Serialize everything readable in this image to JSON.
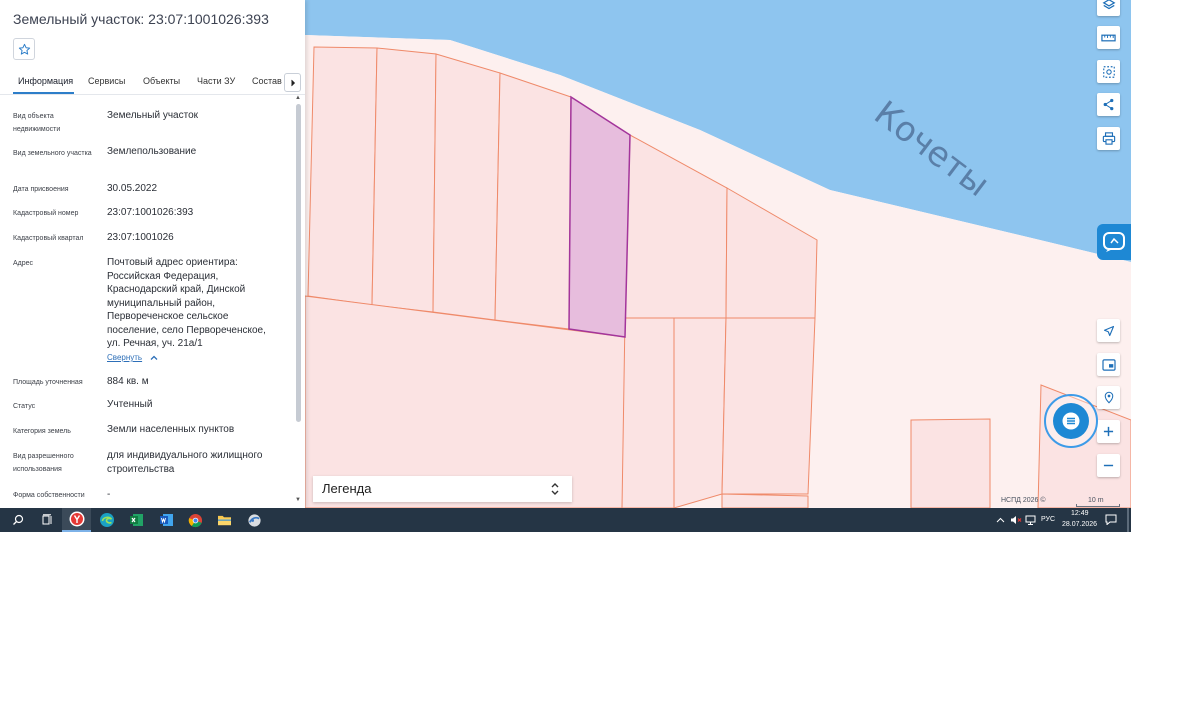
{
  "panel": {
    "title": "Земельный участок: 23:07:1001026:393",
    "tabs": [
      "Информация",
      "Сервисы",
      "Объекты",
      "Части ЗУ",
      "Состав"
    ],
    "fields": [
      {
        "label": "Вид объекта недвижимости",
        "value": "Земельный участок"
      },
      {
        "label": "Вид земельного участка",
        "value": "Землепользование"
      },
      {
        "label": "Дата присвоения",
        "value": "30.05.2022"
      },
      {
        "label": "Кадастровый номер",
        "value": "23:07:1001026:393"
      },
      {
        "label": "Кадастровый квартал",
        "value": "23:07:1001026"
      },
      {
        "label": "Адрес",
        "value": "Почтовый адрес ориентира: Российская Федерация, Краснодарский край, Динской муниципальный район, Первореченское сельское поселение, село Первореченское, ул. Речная, уч. 21а/1"
      },
      {
        "label": "Площадь уточненная",
        "value": "884 кв. м"
      },
      {
        "label": "Статус",
        "value": "Учтенный"
      },
      {
        "label": "Категория земель",
        "value": "Земли населенных пунктов"
      },
      {
        "label": "Вид разрешенного использования",
        "value": "для индивидуального жилищного строительства"
      },
      {
        "label": "Форма собственности",
        "value": "-"
      }
    ],
    "collapse_link": "Свернуть"
  },
  "map": {
    "river_label": "Кочеты",
    "legend_label": "Легенда",
    "attribution": "НСПД 2026 ©",
    "scale_label": "10 m"
  },
  "taskbar": {
    "language": "РУС",
    "time": "12:49",
    "date": "28.07.2026"
  },
  "colors": {
    "river": "#8ec5ef",
    "parcel_fill": "#fbe3e3",
    "parcel_stroke": "#ef8a6a",
    "selected_fill": "#e7bddd",
    "selected_stroke": "#a3359b",
    "accent": "#2d7ec9"
  }
}
